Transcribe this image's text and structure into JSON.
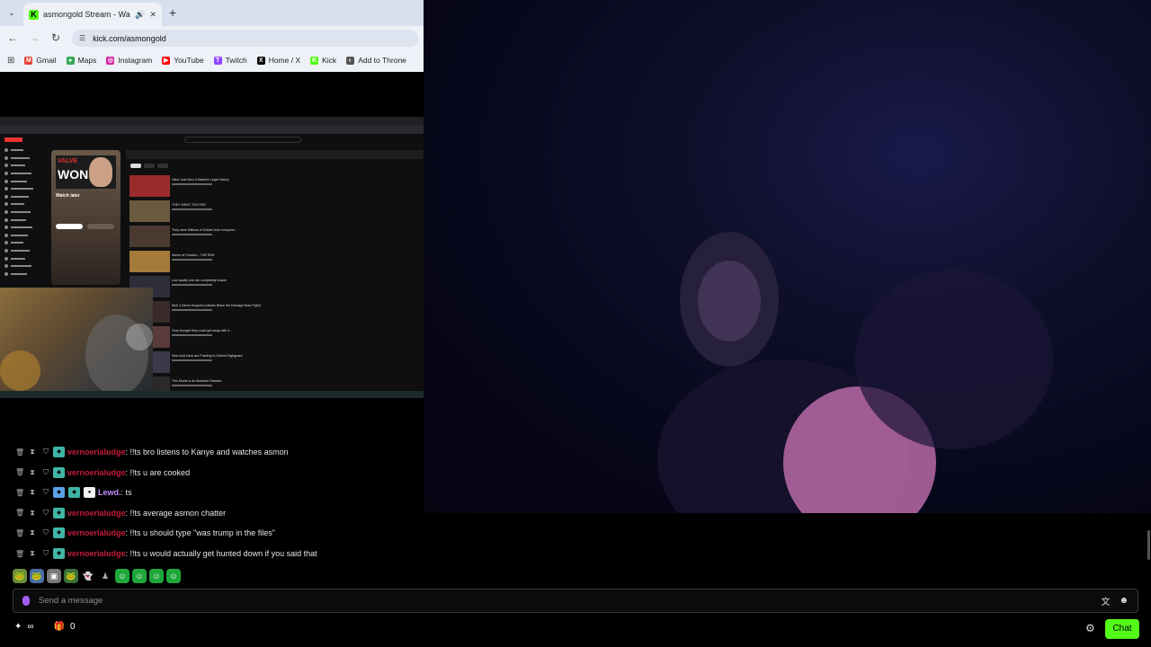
{
  "browser": {
    "tab": {
      "title": "asmongold Stream - Watch",
      "favicon": "K",
      "audio_icon": "🔊",
      "close_icon": "✕"
    },
    "new_tab_icon": "+",
    "tab_menu_icon": "⌄",
    "nav": {
      "back": "←",
      "forward": "→",
      "reload": "↻"
    },
    "address": "kick.com/asmongold",
    "bookmarks": [
      {
        "label": "Gmail",
        "icon": "gmail-icon",
        "color": "#ea4335",
        "glyph": "M"
      },
      {
        "label": "Maps",
        "icon": "maps-icon",
        "color": "#34a853",
        "glyph": "●"
      },
      {
        "label": "Instagram",
        "icon": "instagram-icon",
        "color": "#d6249f",
        "glyph": "◎"
      },
      {
        "label": "YouTube",
        "icon": "youtube-icon",
        "color": "#ff0000",
        "glyph": "▶"
      },
      {
        "label": "Twitch",
        "icon": "twitch-icon",
        "color": "#9146ff",
        "glyph": "T"
      },
      {
        "label": "Home / X",
        "icon": "x-icon",
        "color": "#000000",
        "glyph": "X"
      },
      {
        "label": "Kick",
        "icon": "kick-icon",
        "color": "#53fc18",
        "glyph": "K"
      },
      {
        "label": "Add to Throne",
        "icon": "throne-icon",
        "color": "#555555",
        "glyph": "◐"
      }
    ]
  },
  "inner_screen": {
    "playlist_title": "Watch later",
    "banner_top": "VALVE",
    "banner_bottom": "WON",
    "videos": [
      "Valve Just Won a Massive Legal Victory",
      "THEY WENT TOO FAR",
      "They wore Millions of Dollars from everyone...",
      "Ashes of Creation - THE END",
      "Low quality lore are completely insane",
      "Mob 2 Demo Dropped (Jakobs Blaze the Damage Boss Fight)",
      "They thought they could get away with it...",
      "Now AAA Devs are Pushing to Defend Highguard",
      "This Movie Is An Absolute Disaster"
    ]
  },
  "chat": {
    "messages": [
      {
        "user": "vernoerialudge",
        "user_color": "#c41c3b",
        "text": ": !!ts bro listens to Kanye and watches asmon"
      },
      {
        "user": "vernoerialudge",
        "user_color": "#c41c3b",
        "text": ": !!ts u are cooked"
      },
      {
        "user": "Lewd.",
        "user_color": "#c58cff",
        "text": ": ts"
      },
      {
        "user": "vernoerialudge",
        "user_color": "#c41c3b",
        "text": ": !!ts average asmon chatter"
      },
      {
        "user": "vernoerialudge",
        "user_color": "#c41c3b",
        "text": ": !!ts u should type \"was trump in the files\""
      },
      {
        "user": "vernoerialudge",
        "user_color": "#c41c3b",
        "text": ": !!ts u would actually get hunted down if you said that"
      }
    ],
    "icons": {
      "delete": "🗑",
      "timeout": "⧗",
      "mod": "⛉"
    },
    "input_placeholder": "Send a message",
    "gift_count": "0",
    "viewer_glyph": "∞",
    "chat_button": "Chat"
  },
  "colors": {
    "kick_green": "#53fc18",
    "username_red": "#c41c3b",
    "accent_purple": "#a05ff0"
  }
}
